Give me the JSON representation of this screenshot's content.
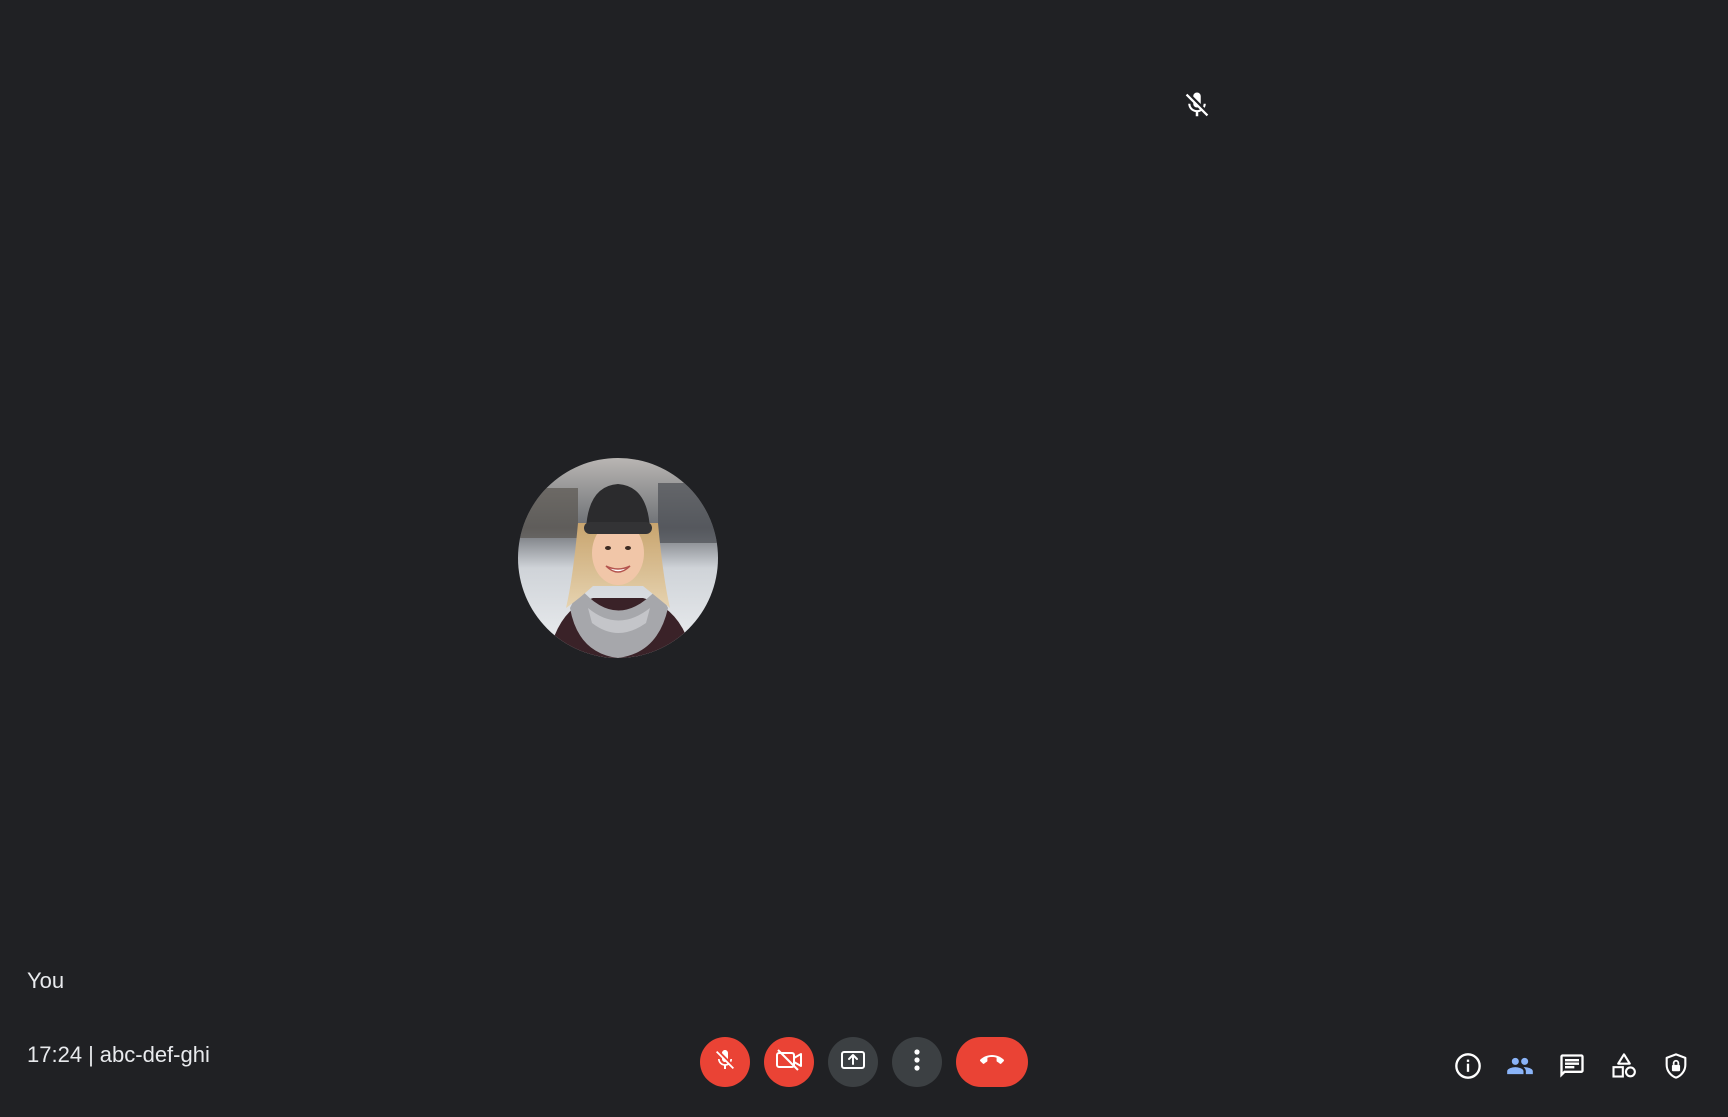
{
  "tile": {
    "participant_name": "You",
    "mic_status_icon": "mic-off-icon",
    "avatar_alt": "profile photo"
  },
  "meeting": {
    "time": "17:24",
    "separator": "|",
    "code": "abc-def-ghi"
  },
  "controls": [
    {
      "name": "microphone-toggle",
      "icon": "mic-off-icon",
      "state": "off"
    },
    {
      "name": "camera-toggle",
      "icon": "camera-off-icon",
      "state": "off"
    },
    {
      "name": "present-screen",
      "icon": "present-icon"
    },
    {
      "name": "more-options",
      "icon": "more-vert-icon"
    },
    {
      "name": "leave-call",
      "icon": "call-end-icon"
    }
  ],
  "side_panel": [
    {
      "name": "meeting-details",
      "icon": "info-icon"
    },
    {
      "name": "people",
      "icon": "people-icon",
      "active": true
    },
    {
      "name": "chat",
      "icon": "chat-icon"
    },
    {
      "name": "activities",
      "icon": "activities-icon"
    },
    {
      "name": "host-controls",
      "icon": "shield-lock-icon"
    }
  ],
  "colors": {
    "background": "#202124",
    "danger": "#ea4335",
    "neutral_button": "#3c4043",
    "accent": "#8ab4f8",
    "text": "#e8eaed"
  }
}
